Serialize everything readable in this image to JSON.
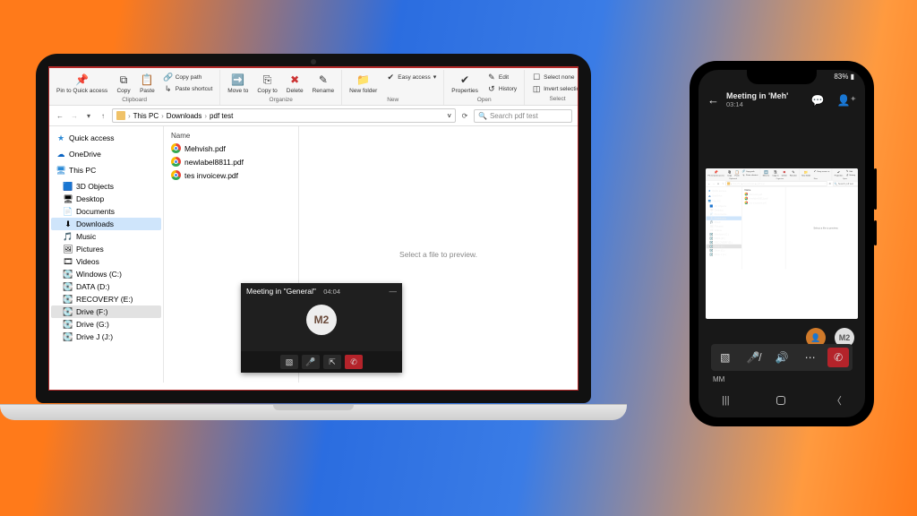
{
  "ribbon": {
    "clipboard": {
      "label": "Clipboard",
      "pin": "Pin to Quick\naccess",
      "copy": "Copy",
      "paste": "Paste",
      "copypath": "Copy path",
      "pasteshortcut": "Paste shortcut"
    },
    "organize": {
      "label": "Organize",
      "moveto": "Move\nto",
      "copyto": "Copy\nto",
      "delete": "Delete",
      "rename": "Rename"
    },
    "new": {
      "label": "New",
      "newfolder": "New\nfolder",
      "easyaccess": "Easy access"
    },
    "open": {
      "label": "Open",
      "properties": "Properties",
      "edit": "Edit",
      "history": "History"
    },
    "select": {
      "label": "Select",
      "selectnone": "Select none",
      "invert": "Invert selection"
    }
  },
  "path": {
    "thispc": "This PC",
    "downloads": "Downloads",
    "pdftest": "pdf test"
  },
  "search": {
    "placeholder": "Search pdf test"
  },
  "nav": {
    "quick": "Quick access",
    "onedrive": "OneDrive",
    "thispc": "This PC",
    "items": [
      "3D Objects",
      "Desktop",
      "Documents",
      "Downloads",
      "Music",
      "Pictures",
      "Videos",
      "Windows (C:)",
      "DATA (D:)",
      "RECOVERY (E:)",
      "Drive (F:)",
      "Drive (G:)",
      "Drive J (J:)"
    ],
    "selected": "Downloads",
    "selected2": "Drive (F:)"
  },
  "files": {
    "header": "Name",
    "items": [
      "Mehvish.pdf",
      "newlabel8811.pdf",
      "tes invoicew.pdf"
    ]
  },
  "preview": {
    "text": "Select a file to preview."
  },
  "teams": {
    "title": "Meeting in \"General\"",
    "time": "04:04",
    "avatar": "M2"
  },
  "phone": {
    "battery": "83%",
    "title": "Meeting in 'Meh'",
    "time": "03:14",
    "label": "MM",
    "avatar2": "M2"
  }
}
